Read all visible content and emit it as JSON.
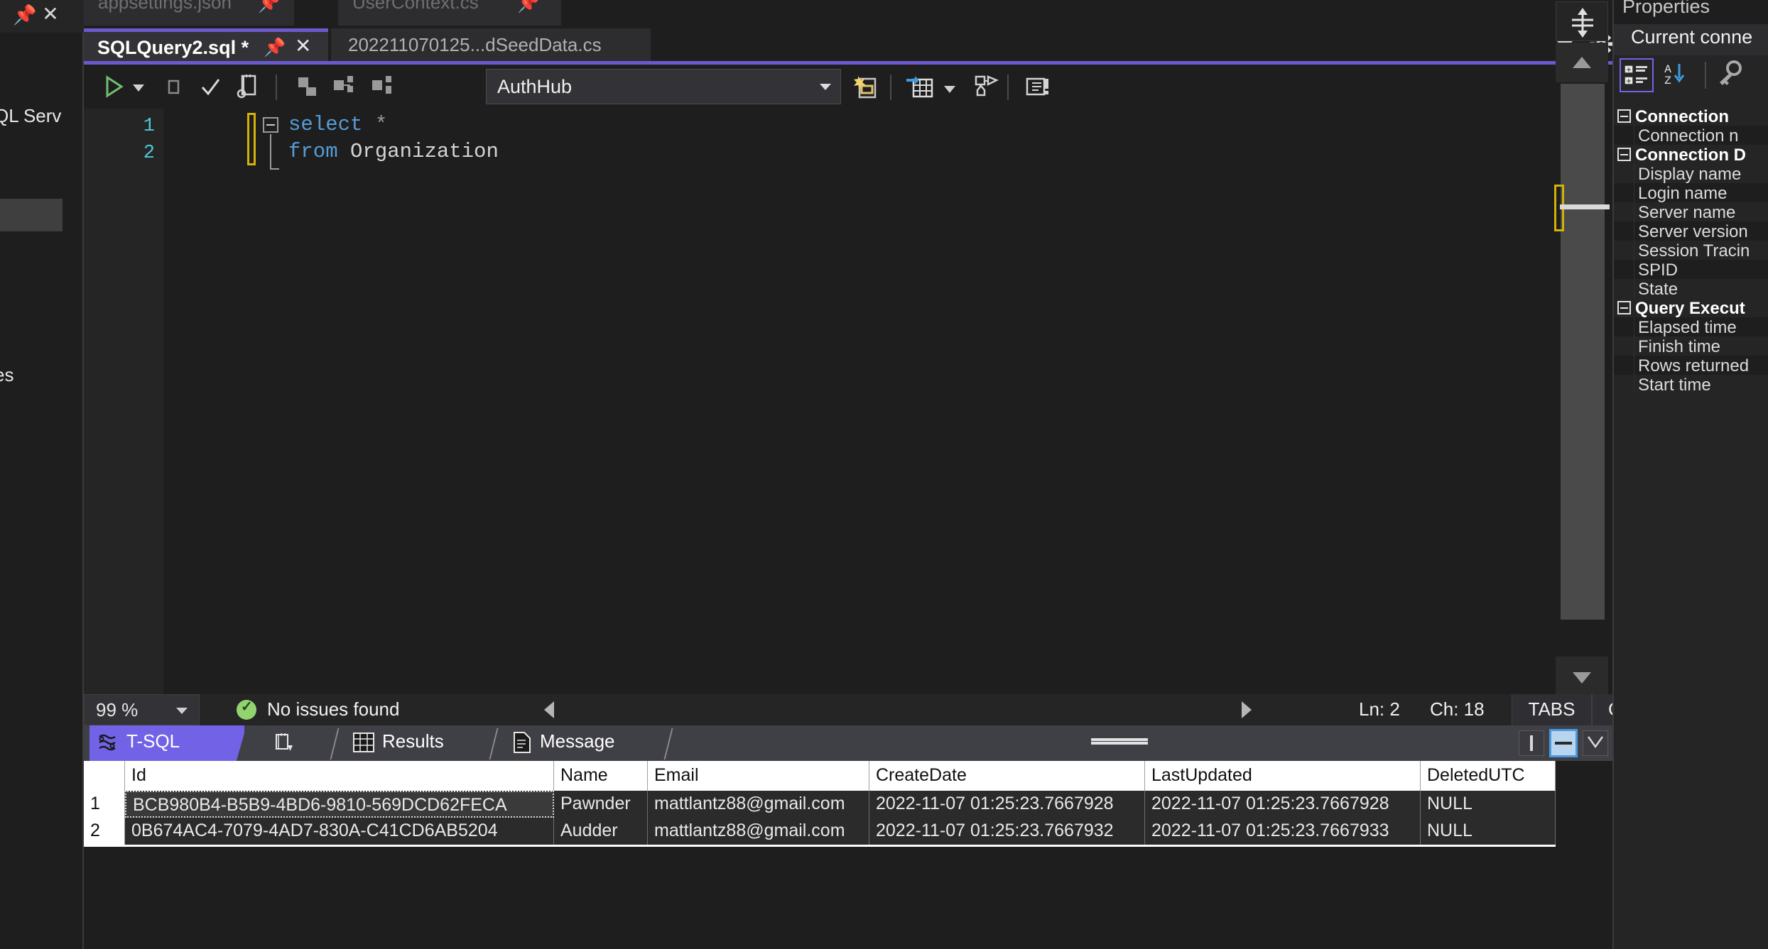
{
  "left_panel": {
    "pin_icon": "pin-icon",
    "close_icon": "close-icon",
    "clipped_label_1": "QL Serv",
    "clipped_label_2": "es"
  },
  "document_tabs": {
    "background_tabs": [
      {
        "label": "appsettings.json",
        "pin_icon": "pin-icon"
      },
      {
        "label": "UserContext.cs",
        "pin_icon": "pin-icon"
      }
    ],
    "active_tab": {
      "label": "SQLQuery2.sql *",
      "pin_icon": "pin-icon",
      "close_icon": "close-icon"
    },
    "inactive_tab": {
      "label": "202211070125...dSeedData.cs"
    },
    "chevron_icon": "chevron-down-icon",
    "gear_icon": "gear-icon",
    "accent_color": "#6a5acd"
  },
  "query_toolbar": {
    "execute_icon": "execute-play-icon",
    "execute_dropdown_icon": "chevron-down-icon",
    "stop_icon": "stop-square-icon",
    "parse_icon": "parse-check-icon",
    "display_plan_icon": "display-estimated-plan-icon",
    "connect_icon": "connect-icon",
    "disconnect_icon": "disconnect-icon",
    "change_connection_icon": "change-connection-icon",
    "database_combo": {
      "value": "AuthHub",
      "arrow_icon": "chevron-down-icon"
    },
    "include_plan_icon": "include-actual-plan-icon",
    "results_to_grid_icon": "results-to-grid-icon",
    "results_dropdown_icon": "chevron-down-icon",
    "query_options_icon": "query-options-icon",
    "properties_window_icon": "properties-window-icon"
  },
  "editor": {
    "line_numbers": [
      "1",
      "2"
    ],
    "lines": [
      {
        "tokens": [
          {
            "t": "select",
            "c": "kw"
          },
          {
            "t": " ",
            "c": "op"
          },
          {
            "t": "*",
            "c": "op"
          }
        ]
      },
      {
        "tokens": [
          {
            "t": "from",
            "c": "kw"
          },
          {
            "t": " ",
            "c": "op"
          },
          {
            "t": "Organization",
            "c": "idt"
          }
        ]
      }
    ],
    "fold_icon": "collapse-outline-icon",
    "split_icon": "split-editor-icon",
    "scroll_up_icon": "scroll-up-arrow-icon",
    "scroll_down_icon": "scroll-down-arrow-icon",
    "scrollbar": "vertical-scrollbar"
  },
  "status_bar": {
    "zoom": "99 %",
    "zoom_arrow_icon": "chevron-down-icon",
    "issues_icon": "check-circle-icon",
    "issues_text": "No issues found",
    "scroll_left_icon": "caret-left-icon",
    "scroll_right_icon": "caret-right-icon",
    "line": "Ln: 2",
    "char": "Ch: 18",
    "indent_mode": "TABS",
    "line_ending": "CRLF"
  },
  "results_pane": {
    "tabs": [
      {
        "label": "T-SQL",
        "icon": "tsql-icon",
        "selected": true
      },
      {
        "label": "",
        "icon": "execution-plan-icon",
        "selected": false
      },
      {
        "label": "Results",
        "icon": "grid-icon",
        "selected": false
      },
      {
        "label": "Message",
        "icon": "message-icon",
        "selected": false
      }
    ],
    "selected_color": "#7263e6",
    "grip_icon": "splitter-grip-icon",
    "view_buttons": [
      {
        "icon": "split-vertical-icon",
        "active": false
      },
      {
        "icon": "split-horizontal-icon",
        "active": true
      },
      {
        "icon": "hide-results-icon",
        "active": false
      }
    ]
  },
  "results_grid": {
    "columns": [
      "Id",
      "Name",
      "Email",
      "CreateDate",
      "LastUpdated",
      "DeletedUTC"
    ],
    "rows": [
      {
        "num": "1",
        "cells": [
          "BCB980B4-B5B9-4BD6-9810-569DCD62FECA",
          "Pawnder",
          "mattlantz88@gmail.com",
          "2022-11-07 01:25:23.7667928",
          "2022-11-07 01:25:23.7667928",
          "NULL"
        ],
        "selected_cell": 0
      },
      {
        "num": "2",
        "cells": [
          "0B674AC4-7079-4AD7-830A-C41CD6AB5204",
          "Audder",
          "mattlantz88@gmail.com",
          "2022-11-07 01:25:23.7667932",
          "2022-11-07 01:25:23.7667933",
          "NULL"
        ],
        "selected_cell": -1
      }
    ]
  },
  "properties_panel": {
    "title": "Properties",
    "subtitle": "Current conne",
    "toolbar": [
      {
        "icon": "categorized-icon",
        "active": true
      },
      {
        "icon": "alphabetical-sort-icon",
        "active": false
      },
      {
        "icon": "property-pages-key-icon",
        "active": false
      }
    ],
    "rows": [
      {
        "type": "group",
        "label": "Connection"
      },
      {
        "type": "item",
        "label": "Connection n"
      },
      {
        "type": "group",
        "label": "Connection D"
      },
      {
        "type": "item",
        "label": "Display name"
      },
      {
        "type": "item",
        "label": "Login name"
      },
      {
        "type": "item",
        "label": "Server name"
      },
      {
        "type": "item",
        "label": "Server version"
      },
      {
        "type": "item",
        "label": "Session Tracin"
      },
      {
        "type": "item",
        "label": "SPID"
      },
      {
        "type": "item",
        "label": "State"
      },
      {
        "type": "group",
        "label": "Query Execut"
      },
      {
        "type": "item",
        "label": "Elapsed time"
      },
      {
        "type": "item",
        "label": "Finish time"
      },
      {
        "type": "item",
        "label": "Rows returned"
      },
      {
        "type": "item",
        "label": "Start time"
      }
    ]
  }
}
